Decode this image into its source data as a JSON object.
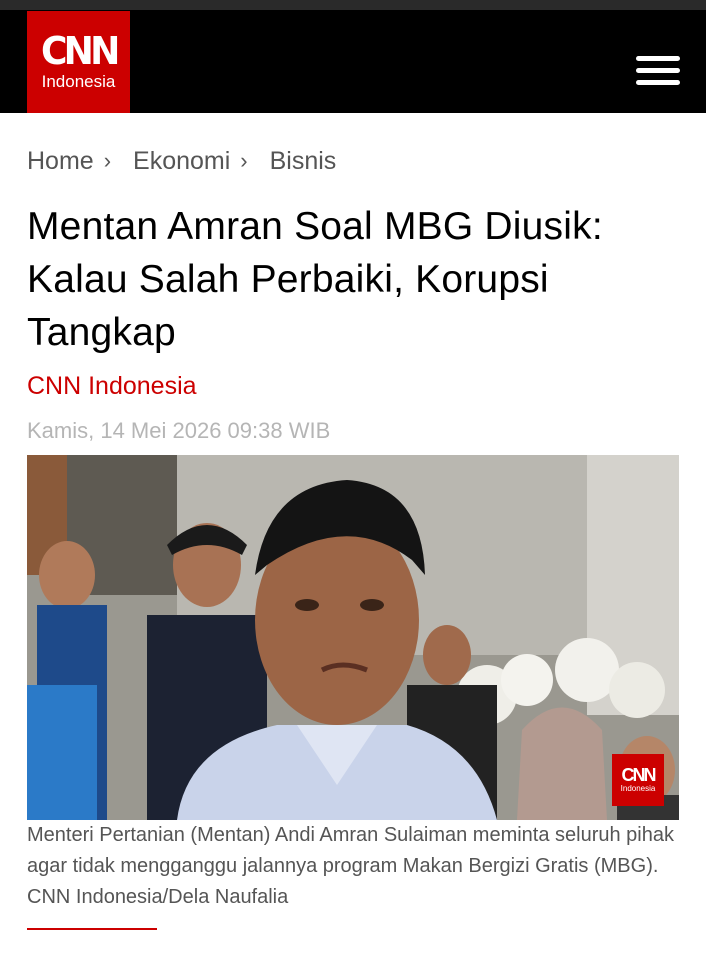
{
  "header": {
    "logo_mark": "CNN",
    "logo_sub": "Indonesia",
    "menu_icon": "hamburger-menu-icon"
  },
  "breadcrumb": {
    "items": [
      "Home",
      "Ekonomi",
      "Bisnis"
    ],
    "separator": "›"
  },
  "article": {
    "title": "Mentan Amran Soal MBG Diusik: Kalau Salah Perbaiki, Korupsi Tangkap",
    "source": "CNN Indonesia",
    "date": "Kamis, 14 Mei 2026 09:38 WIB",
    "photo_watermark_mark": "CNN",
    "photo_watermark_sub": "Indonesia",
    "caption": "Menteri Pertanian (Mentan) Andi Amran Sulaiman meminta seluruh pihak agar tidak mengganggu jalannya program Makan Bergizi Gratis (MBG). CNN Indonesia/Dela Naufalia"
  },
  "colors": {
    "brand_red": "#cc0000",
    "header_bg": "#000000",
    "date_gray": "#b5b5b5",
    "caption_gray": "#555555"
  }
}
